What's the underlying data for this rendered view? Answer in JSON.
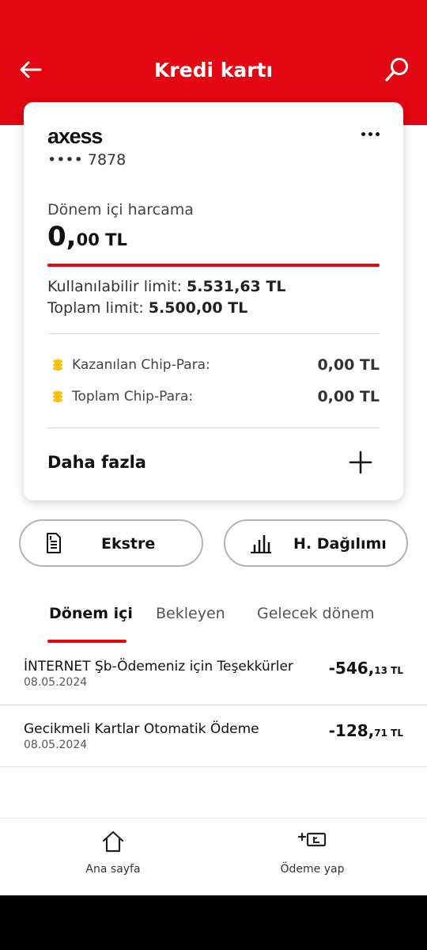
{
  "header": {
    "title": "Kredi kartı",
    "back_icon": "arrow-left-icon",
    "search_icon": "search-icon",
    "background_color": "#e30613"
  },
  "card": {
    "brand": "axess",
    "masked_number": "•••• 7878",
    "more_icon": "more-horizontal-icon",
    "period_spending_label": "Dönem içi harcama",
    "period_spending_amount_int": "0,",
    "period_spending_amount_dec": "00 TL",
    "available_limit_label": "Kullanılabilir limit:",
    "available_limit_value": "5.531,63 TL",
    "total_limit_label": "Toplam limit:",
    "total_limit_value": "5.500,00 TL",
    "chip_rows": [
      {
        "label": "Kazanılan Chip-Para:",
        "value": "0,00 TL",
        "icon": "coins-icon"
      },
      {
        "label": "Toplam Chip-Para:",
        "value": "0,00 TL",
        "icon": "coins-icon"
      }
    ],
    "more_label": "Daha fazla",
    "more_action_icon": "plus-icon"
  },
  "actions": [
    {
      "label": "Ekstre",
      "icon": "statement-icon"
    },
    {
      "label": "H. Dağılımı",
      "icon": "bar-chart-icon"
    }
  ],
  "tabs": [
    {
      "label": "Dönem içi",
      "active": true
    },
    {
      "label": "Bekleyen",
      "active": false
    },
    {
      "label": "Gelecek dönem",
      "active": false
    }
  ],
  "transactions": [
    {
      "title": "İNTERNET Şb-Ödemeniz için Teşekkürler",
      "date": "08.05.2024",
      "amount_int": "-546,",
      "amount_dec": "13 TL"
    },
    {
      "title": "Gecikmeli Kartlar Otomatik Ödeme",
      "date": "08.05.2024",
      "amount_int": "-128,",
      "amount_dec": "71 TL"
    }
  ],
  "bottom_nav": [
    {
      "label": "Ana sayfa",
      "icon": "home-icon"
    },
    {
      "label": "Ödeme yap",
      "icon": "payment-icon"
    }
  ],
  "colors": {
    "accent": "#e30613",
    "coin": "#f4c20d"
  }
}
